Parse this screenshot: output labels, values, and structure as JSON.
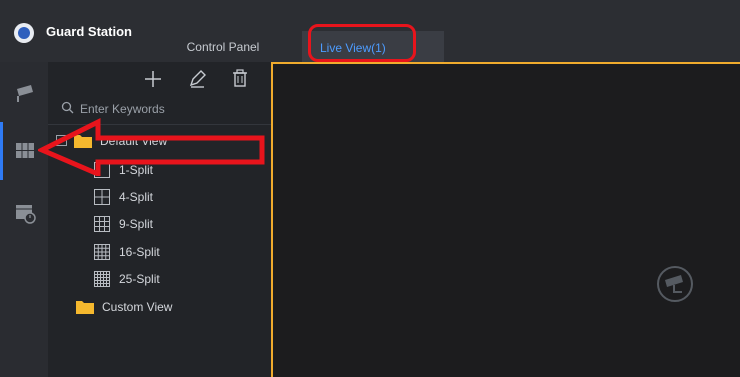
{
  "header": {
    "app_title": "Guard Station"
  },
  "tabs": [
    {
      "label": "Control Panel"
    },
    {
      "label": "Live View(1)"
    }
  ],
  "colors": {
    "accent": "#2f7bf5",
    "tab_text": "#4d9cff",
    "frame": "#f0ab2d",
    "annotation": "#e8141c"
  },
  "sidebar_icons": [
    "camera-icon",
    "view-grid-icon",
    "playback-icon"
  ],
  "toolbar": {
    "add_icon": "plus-icon",
    "edit_icon": "pencil-icon",
    "delete_icon": "trash-icon"
  },
  "search": {
    "placeholder": "Enter Keywords"
  },
  "tree": {
    "default_view": {
      "label": "Default View",
      "expanded": true
    },
    "splits": [
      {
        "label": "1-Split"
      },
      {
        "label": "4-Split"
      },
      {
        "label": "9-Split"
      },
      {
        "label": "16-Split"
      },
      {
        "label": "25-Split"
      }
    ],
    "custom_view": {
      "label": "Custom View"
    }
  }
}
